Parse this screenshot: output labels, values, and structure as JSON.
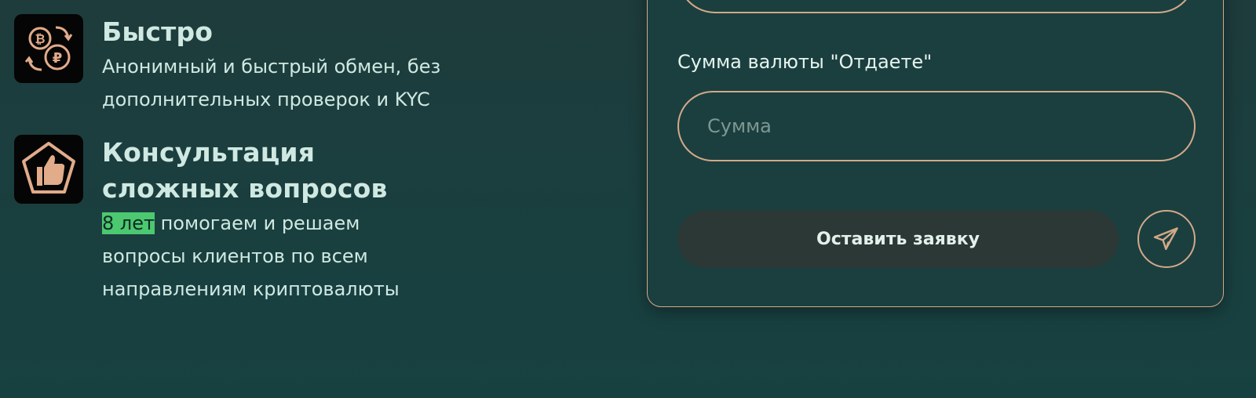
{
  "features": [
    {
      "title": "Быстро",
      "desc_lines": [
        "Анонимный и быстрый обмен, без",
        "дополнительных проверок и KYC"
      ],
      "icon": "currency-exchange-icon"
    },
    {
      "title_lines": [
        "Консультация",
        "сложных вопросов"
      ],
      "highlight": "8 лет",
      "desc_line1_rest": " помогаем и решаем",
      "desc_lines_rest": [
        "вопросы клиентов по всем",
        "направлениям криптовалюты"
      ],
      "icon": "thumbs-up-icon"
    }
  ],
  "form": {
    "amount_label": "Сумма валюты \"Отдаете\"",
    "amount_placeholder": "Сумма",
    "submit_label": "Оставить заявку",
    "telegram_icon": "telegram-send-icon"
  },
  "colors": {
    "accent": "#d2a989",
    "background": "#1e3c3c",
    "highlight": "#4bc870",
    "button": "#2b3835"
  }
}
